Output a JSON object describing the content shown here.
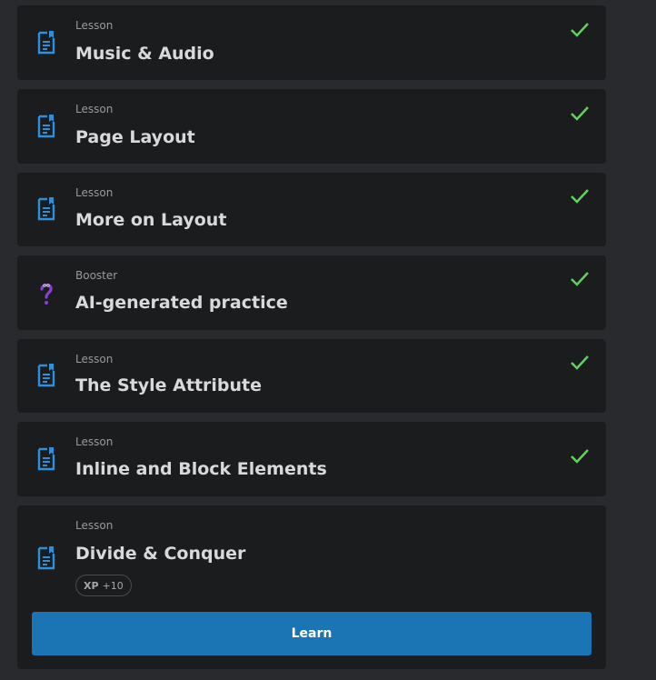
{
  "colors": {
    "page_bg": "#292a2d",
    "card_bg": "#1b1c1e",
    "lesson_icon": "#2f8fd8",
    "booster_icon": "#8a3fd1",
    "check": "#5ed45a",
    "button_bg": "#1b74b4"
  },
  "items": [
    {
      "type": "Lesson",
      "title": "Music & Audio",
      "icon": "lesson-document-icon",
      "completed": true
    },
    {
      "type": "Lesson",
      "title": "Page Layout",
      "icon": "lesson-document-icon",
      "completed": true
    },
    {
      "type": "Lesson",
      "title": "More on Layout",
      "icon": "lesson-document-icon",
      "completed": true
    },
    {
      "type": "Booster",
      "title": "AI-generated practice",
      "icon": "question-mark-icon",
      "completed": true
    },
    {
      "type": "Lesson",
      "title": "The Style Attribute",
      "icon": "lesson-document-icon",
      "completed": true
    },
    {
      "type": "Lesson",
      "title": "Inline and Block Elements",
      "icon": "lesson-document-icon",
      "completed": true
    }
  ],
  "current": {
    "type": "Lesson",
    "title": "Divide & Conquer",
    "icon": "lesson-document-icon",
    "xp_label": "XP",
    "xp_value": "+10",
    "button_label": "Learn"
  }
}
